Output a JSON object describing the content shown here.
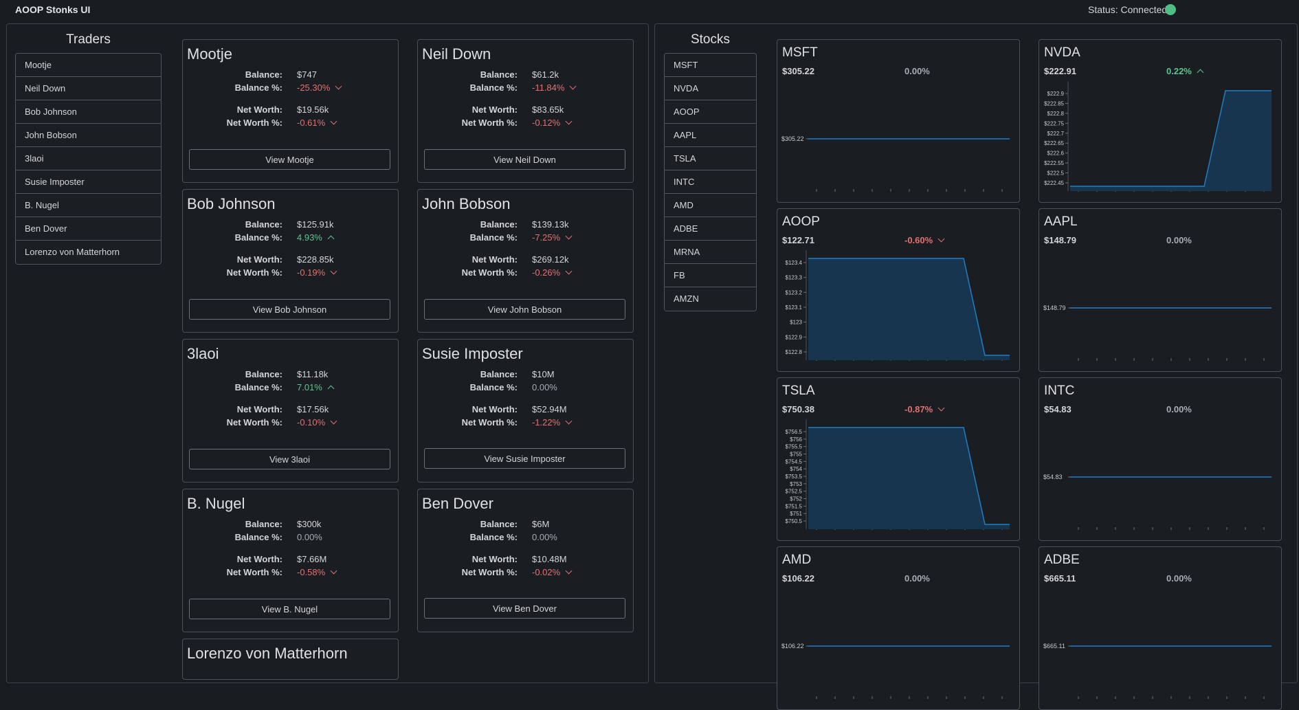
{
  "app": {
    "title": "AOOP Stonks UI",
    "status": "Status: Connected",
    "status_color": "#4fbd84"
  },
  "colors": {
    "positive": "#5fc48f",
    "negative": "#e5716f",
    "neutral": "#a9adb3",
    "chart_line": "#1f7fc4",
    "chart_fill": "#17354f"
  },
  "traders_panel": {
    "title": "Traders",
    "list": [
      "Mootje",
      "Neil Down",
      "Bob Johnson",
      "John Bobson",
      "3laoi",
      "Susie Imposter",
      "B. Nugel",
      "Ben Dover",
      "Lorenzo von Matterhorn"
    ],
    "labels": {
      "balance": "Balance:",
      "balance_pct": "Balance %:",
      "net_worth": "Net Worth:",
      "net_worth_pct": "Net Worth %:"
    },
    "cards": [
      {
        "name": "Mootje",
        "balance": "$747",
        "balance_pct": "-25.30%",
        "balance_dir": "down",
        "net_worth": "$19.56k",
        "net_worth_pct": "-0.61%",
        "net_worth_dir": "down",
        "button": "View Mootje"
      },
      {
        "name": "Neil Down",
        "balance": "$61.2k",
        "balance_pct": "-11.84%",
        "balance_dir": "down",
        "net_worth": "$83.65k",
        "net_worth_pct": "-0.12%",
        "net_worth_dir": "down",
        "button": "View Neil Down"
      },
      {
        "name": "Bob Johnson",
        "balance": "$125.91k",
        "balance_pct": "4.93%",
        "balance_dir": "up",
        "net_worth": "$228.85k",
        "net_worth_pct": "-0.19%",
        "net_worth_dir": "down",
        "button": "View Bob Johnson"
      },
      {
        "name": "John Bobson",
        "balance": "$139.13k",
        "balance_pct": "-7.25%",
        "balance_dir": "down",
        "net_worth": "$269.12k",
        "net_worth_pct": "-0.26%",
        "net_worth_dir": "down",
        "button": "View John Bobson"
      },
      {
        "name": "3laoi",
        "balance": "$11.18k",
        "balance_pct": "7.01%",
        "balance_dir": "up",
        "net_worth": "$17.56k",
        "net_worth_pct": "-0.10%",
        "net_worth_dir": "down",
        "button": "View 3laoi"
      },
      {
        "name": "Susie Imposter",
        "balance": "$10M",
        "balance_pct": "0.00%",
        "balance_dir": "none",
        "net_worth": "$52.94M",
        "net_worth_pct": "-1.22%",
        "net_worth_dir": "down",
        "button": "View Susie Imposter"
      },
      {
        "name": "B. Nugel",
        "balance": "$300k",
        "balance_pct": "0.00%",
        "balance_dir": "none",
        "net_worth": "$7.66M",
        "net_worth_pct": "-0.58%",
        "net_worth_dir": "down",
        "button": "View B. Nugel"
      },
      {
        "name": "Ben Dover",
        "balance": "$6M",
        "balance_pct": "0.00%",
        "balance_dir": "none",
        "net_worth": "$10.48M",
        "net_worth_pct": "-0.02%",
        "net_worth_dir": "down",
        "button": "View Ben Dover"
      },
      {
        "name": "Lorenzo von Matterhorn"
      }
    ]
  },
  "stocks_panel": {
    "title": "Stocks",
    "list": [
      "MSFT",
      "NVDA",
      "AOOP",
      "AAPL",
      "TSLA",
      "INTC",
      "AMD",
      "ADBE",
      "MRNA",
      "FB",
      "AMZN"
    ],
    "cards": [
      {
        "symbol": "MSFT",
        "price": "$305.22",
        "change": "0.00%",
        "dir": "none",
        "chart": {
          "type": "flat",
          "ticks": [
            "$305.22"
          ]
        }
      },
      {
        "symbol": "NVDA",
        "price": "$222.91",
        "change": "0.22%",
        "dir": "up",
        "chart": {
          "type": "up",
          "ticks": [
            "$222.9",
            "$222.85",
            "$222.8",
            "$222.75",
            "$222.7",
            "$222.65",
            "$222.6",
            "$222.55",
            "$222.5",
            "$222.45"
          ]
        }
      },
      {
        "symbol": "AOOP",
        "price": "$122.71",
        "change": "-0.60%",
        "dir": "down",
        "chart": {
          "type": "down",
          "ticks": [
            "$123.4",
            "$123.3",
            "$123.2",
            "$123.1",
            "$123",
            "$122.9",
            "$122.8"
          ]
        }
      },
      {
        "symbol": "AAPL",
        "price": "$148.79",
        "change": "0.00%",
        "dir": "none",
        "chart": {
          "type": "flat",
          "ticks": [
            "$148.79"
          ]
        }
      },
      {
        "symbol": "TSLA",
        "price": "$750.38",
        "change": "-0.87%",
        "dir": "down",
        "chart": {
          "type": "down",
          "ticks": [
            "$756.5",
            "$756",
            "$755.5",
            "$755",
            "$754.5",
            "$754",
            "$753.5",
            "$753",
            "$752.5",
            "$752",
            "$751.5",
            "$751",
            "$750.5"
          ]
        }
      },
      {
        "symbol": "INTC",
        "price": "$54.83",
        "change": "0.00%",
        "dir": "none",
        "chart": {
          "type": "flat",
          "ticks": [
            "$54.83"
          ]
        }
      },
      {
        "symbol": "AMD",
        "price": "$106.22",
        "change": "0.00%",
        "dir": "none",
        "chart": {
          "type": "flat",
          "ticks": [
            "$106.22"
          ]
        }
      },
      {
        "symbol": "ADBE",
        "price": "$665.11",
        "change": "0.00%",
        "dir": "none",
        "chart": {
          "type": "flat",
          "ticks": [
            "$665.11"
          ]
        }
      }
    ]
  }
}
